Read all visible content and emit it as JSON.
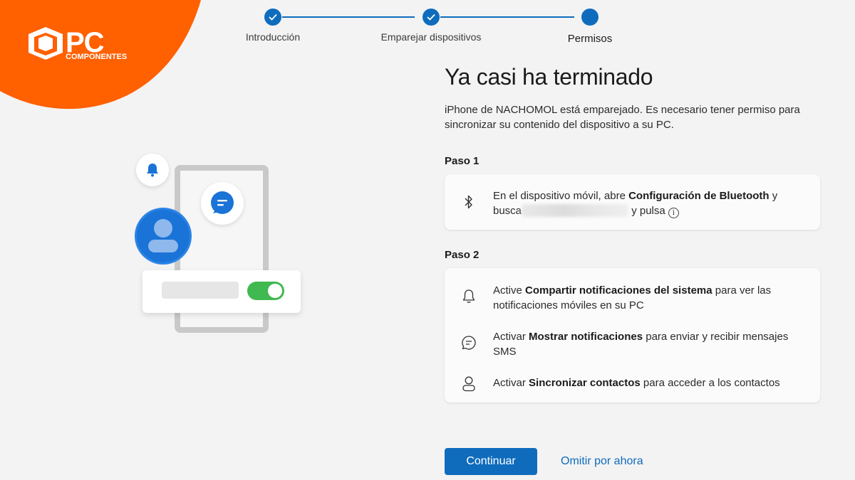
{
  "brand": {
    "logo_text": "PC",
    "logo_subtext": "COMPONENTES",
    "color": "#ff6000"
  },
  "stepper": {
    "steps": [
      {
        "label": "Introducción",
        "state": "completed"
      },
      {
        "label": "Emparejar dispositivos",
        "state": "completed"
      },
      {
        "label": "Permisos",
        "state": "current"
      }
    ],
    "accent": "#0f6cbd"
  },
  "main": {
    "title": "Ya casi ha terminado",
    "description": "iPhone de NACHOMOL está emparejado. Es necesario tener permiso para sincronizar su contenido del dispositivo a su PC.",
    "step1": {
      "label": "Paso 1",
      "icon": "bluetooth-icon",
      "text_before": "En el dispositivo móvil, abre ",
      "text_bold": "Configuración de Bluetooth",
      "text_after": " y",
      "text_line2_before": "busca",
      "text_line2_after": "y pulsa"
    },
    "step2": {
      "label": "Paso 2",
      "items": [
        {
          "icon": "bell-icon",
          "before": "Active ",
          "bold": "Compartir notificaciones del sistema",
          "after": " para ver las notificaciones móviles en su PC"
        },
        {
          "icon": "chat-icon",
          "before": "Activar ",
          "bold": "Mostrar notificaciones",
          "after": " para enviar y recibir mensajes SMS"
        },
        {
          "icon": "person-icon",
          "before": "Activar ",
          "bold": "Sincronizar contactos",
          "after": " para acceder a los contactos"
        }
      ]
    }
  },
  "actions": {
    "continue_label": "Continuar",
    "skip_label": "Omitir por ahora"
  }
}
